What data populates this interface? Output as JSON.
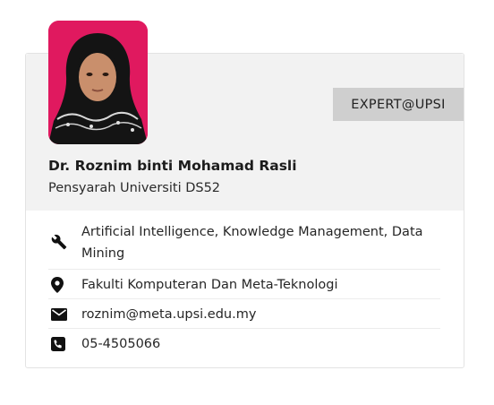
{
  "profile": {
    "badge": "EXPERT@UPSI",
    "name": "Dr. Roznim binti Mohamad Rasli",
    "position": "Pensyarah Universiti DS52"
  },
  "details": {
    "expertise": "Artificial Intelligence, Knowledge Management, Data Mining",
    "faculty": "Fakulti Komputeran Dan Meta-Teknologi",
    "email": "roznim@meta.upsi.edu.my",
    "phone": "05-4505066"
  },
  "icons": {
    "expertise": "wrench-icon",
    "faculty": "map-pin-icon",
    "email": "envelope-icon",
    "phone": "phone-icon"
  },
  "colors": {
    "photo_background": "#e0195f",
    "header_background": "#f2f2f2",
    "badge_background": "#cfcfcf",
    "link": "#3d78b0"
  }
}
